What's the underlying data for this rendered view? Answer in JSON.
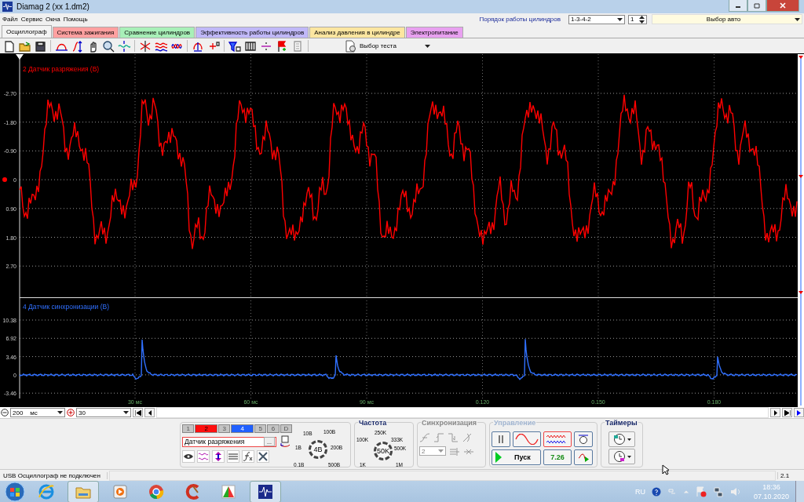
{
  "window": {
    "title": "Diamag 2 (xx 1.dm2)"
  },
  "menu": [
    "Файл",
    "Сервис",
    "Окна",
    "Помощь"
  ],
  "cylinder_order": {
    "label": "Порядок работы цилиндров",
    "value": "1-3-4-2",
    "cylinder": "1"
  },
  "car_select": {
    "value": "Выбор авто"
  },
  "tabs": [
    {
      "label": "Осциллограф",
      "selected": true,
      "color": "#f4f4f4"
    },
    {
      "label": "Система зажигания",
      "selected": false,
      "color": "#ffa0a0"
    },
    {
      "label": "Сравнение цилиндров",
      "selected": false,
      "color": "#a8f0b8"
    },
    {
      "label": "Эффективность работы цилиндров",
      "selected": false,
      "color": "#c0b8f8"
    },
    {
      "label": "Анализ давления в цилиндре",
      "selected": false,
      "color": "#fce6a0"
    },
    {
      "label": "Электропитание",
      "selected": false,
      "color": "#e8a0f0"
    }
  ],
  "test_select": {
    "value": "Выбор теста"
  },
  "panels": [
    {
      "title": "2 Датчик разряжения (В)",
      "kind": "vacuum",
      "color": "#ff0000",
      "yticks": [
        "-2.70",
        "-1.80",
        "-0.90",
        "0",
        "0.90",
        "1.80",
        "2.70"
      ]
    },
    {
      "title": "4 Датчик синхронизации (В)",
      "kind": "sync",
      "color": "#3070ff",
      "yticks": [
        "10.38",
        "6.92",
        "3.46",
        "0",
        "-3.46"
      ]
    }
  ],
  "xticks": [
    "30 мс",
    "60 мс",
    "90 мс",
    "0.120",
    "0.150",
    "0.180"
  ],
  "timebase": {
    "value": "200",
    "unit": "мс"
  },
  "frames": "30",
  "channel_buttons": [
    {
      "label": "1",
      "on": false,
      "color": "#c4c4c4"
    },
    {
      "label": "2",
      "on": true,
      "color": "#ff1010"
    },
    {
      "label": "3",
      "on": false,
      "color": "#c4c4c4"
    },
    {
      "label": "4",
      "on": true,
      "color": "#2060ff"
    },
    {
      "label": "5",
      "on": false,
      "color": "#c4c4c4"
    },
    {
      "label": "6",
      "on": false,
      "color": "#c4c4c4"
    },
    {
      "label": "D",
      "on": false,
      "color": "#c4c4c4"
    }
  ],
  "channel_name": "Датчик разряжения",
  "channel_more": "...",
  "voltage_knob": {
    "value": "4В",
    "labels": [
      "10В",
      "100В",
      "1В",
      "200В",
      "0.1В",
      "500В"
    ]
  },
  "frequency": {
    "title": "Частота",
    "value": "50K",
    "labels": [
      "250K",
      "100K",
      "333K",
      "500K",
      "1K",
      "1M"
    ]
  },
  "sync": {
    "title": "Синхронизация",
    "channel": "2",
    "disabled": true
  },
  "control": {
    "title": "Управление",
    "start": "Пуск",
    "reading": "7.26"
  },
  "timers": {
    "title": "Таймеры"
  },
  "status_bar": {
    "message": "USB Осциллограф не подключен",
    "version": "2.1"
  },
  "taskbar": {
    "language": "RU",
    "time": "18:36",
    "date": "07.10.2020"
  }
}
